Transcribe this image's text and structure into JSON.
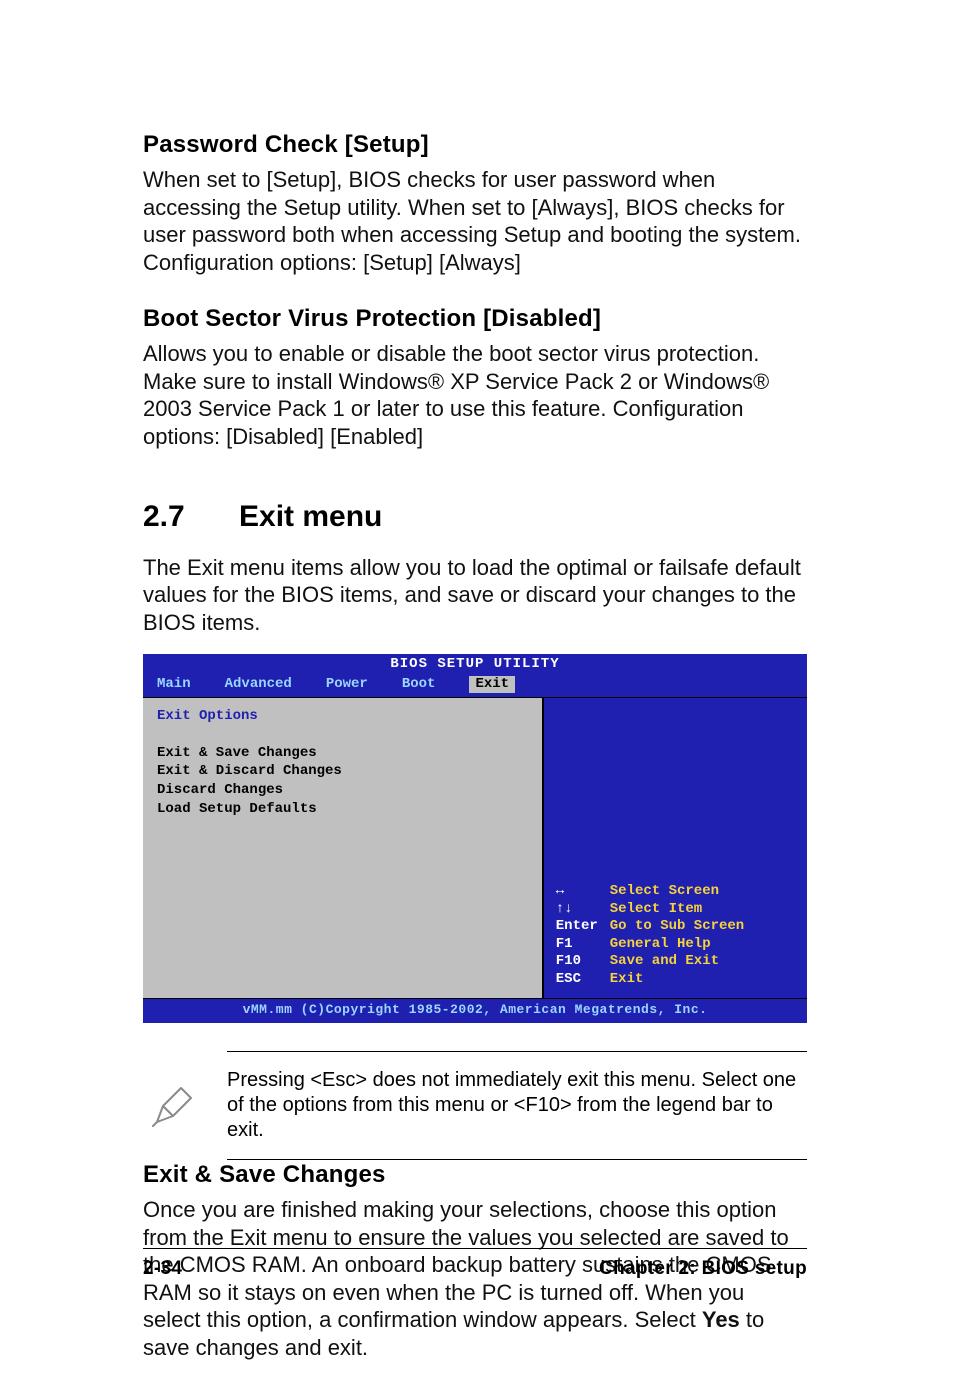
{
  "section1": {
    "title": "Password Check [Setup]",
    "body": "When set to [Setup], BIOS checks for user password when accessing the Setup utility. When set to [Always], BIOS checks for user password both when accessing Setup and booting the system.\nConfiguration options: [Setup] [Always]"
  },
  "section2": {
    "title": "Boot Sector Virus Protection [Disabled]",
    "body": "Allows you to enable or disable the boot sector virus protection. Make sure to install Windows® XP Service Pack 2 or Windows® 2003 Service Pack 1 or later to use this feature. Configuration options: [Disabled] [Enabled]"
  },
  "heading": {
    "number": "2.7",
    "title": "Exit menu",
    "intro": "The Exit menu items allow you to load the optimal or failsafe default values for the BIOS items, and save or discard your changes to the BIOS items."
  },
  "bios": {
    "title": "BIOS SETUP UTILITY",
    "tabs": [
      "Main",
      "Advanced",
      "Power",
      "Boot",
      "Exit"
    ],
    "active_tab": "Exit",
    "group": "Exit Options",
    "items": [
      "Exit & Save Changes",
      "Exit & Discard Changes",
      "Discard Changes",
      "",
      "Load Setup Defaults"
    ],
    "legend": [
      {
        "key": "↔",
        "val": "Select Screen"
      },
      {
        "key": "↑↓",
        "val": "Select Item"
      },
      {
        "key": "Enter",
        "val": "Go to Sub Screen"
      },
      {
        "key": "F1",
        "val": "General Help"
      },
      {
        "key": "F10",
        "val": "Save and Exit"
      },
      {
        "key": "ESC",
        "val": "Exit"
      }
    ],
    "footer": "vMM.mm (C)Copyright 1985-2002, American Megatrends, Inc."
  },
  "note": "Pressing <Esc> does not immediately exit this menu. Select one of the options from this menu or <F10> from the legend bar to exit.",
  "section3": {
    "title": "Exit & Save Changes",
    "body_pre": "Once you are finished making your selections, choose this option from the Exit menu to ensure the values you selected are saved to the CMOS RAM. An onboard backup battery sustains the CMOS RAM so it stays on even when the PC is turned off. When you select this option, a confirmation window appears. Select ",
    "body_bold": "Yes",
    "body_post": " to save changes and exit."
  },
  "footer": {
    "page": "2-34",
    "chapter": "Chapter 2: BIOS setup"
  }
}
